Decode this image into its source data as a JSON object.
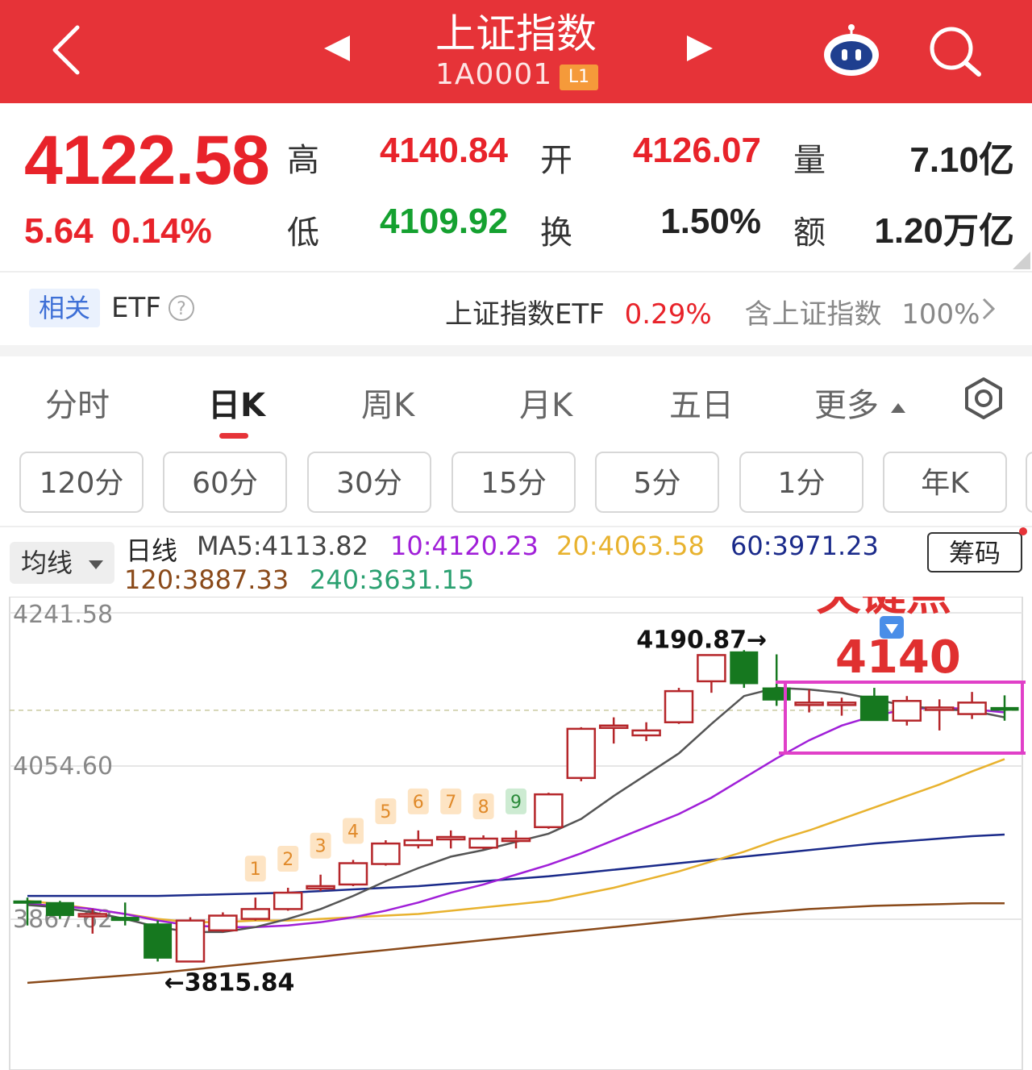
{
  "header": {
    "title": "上证指数",
    "code": "1A0001",
    "level_badge": "L1"
  },
  "quote": {
    "price": "4122.58",
    "change": "5.64",
    "change_pct": "0.14%",
    "high_label": "高",
    "high": "4140.84",
    "open_label": "开",
    "open": "4126.07",
    "volume_label": "量",
    "volume": "7.10亿",
    "low_label": "低",
    "low": "4109.92",
    "turnover_label": "换",
    "turnover": "1.50%",
    "amount_label": "额",
    "amount": "1.20万亿"
  },
  "etf": {
    "tag": "相关",
    "label": "ETF",
    "name": "上证指数ETF",
    "pct": "0.29%",
    "contain_text": "含上证指数",
    "contain_pct": "100%"
  },
  "tabs": [
    "分时",
    "日K",
    "周K",
    "月K",
    "五日",
    "更多"
  ],
  "active_tab": "日K",
  "periods": [
    "120分",
    "60分",
    "30分",
    "15分",
    "5分",
    "1分",
    "年K"
  ],
  "legend": {
    "ma_button": "均线",
    "line_name": "日线",
    "ma5": "MA5:4113.82",
    "ma10": "10:4120.23",
    "ma20": "20:4063.58",
    "ma60": "60:3971.23",
    "ma120": "120:3887.33",
    "ma240": "240:3631.15",
    "chip_button": "筹码"
  },
  "colors": {
    "header_red": "#e63338",
    "up": "#b5262a",
    "down": "#16781f",
    "ma5": "#555555",
    "ma10": "#a01fd8",
    "ma20": "#e8b22e",
    "ma60": "#1a2a8a",
    "ma120": "#8a4a1a",
    "ma240": "#2aa070",
    "annotation": "#e03030",
    "box": "#e040c8"
  },
  "chart_data": {
    "type": "candlestick",
    "y_axis_ticks": [
      "4241.58",
      "4054.60",
      "3867.62"
    ],
    "ylim": [
      3800,
      4241.58
    ],
    "max_label": "4190.87→",
    "min_label": "←3815.84",
    "annotation_title": "关键点",
    "annotation_value": "4140",
    "annotation_icon": "down-arrow-icon",
    "count_labels": [
      "1",
      "2",
      "3",
      "4",
      "5",
      "6",
      "7",
      "8",
      "9"
    ],
    "candles": [
      {
        "o": 3890,
        "h": 3894,
        "l": 3860,
        "c": 3888
      },
      {
        "o": 3888,
        "h": 3890,
        "l": 3868,
        "c": 3872
      },
      {
        "o": 3874,
        "h": 3880,
        "l": 3850,
        "c": 3874
      },
      {
        "o": 3870,
        "h": 3888,
        "l": 3860,
        "c": 3866
      },
      {
        "o": 3862,
        "h": 3866,
        "l": 3816,
        "c": 3820
      },
      {
        "o": 3816,
        "h": 3870,
        "l": 3815,
        "c": 3866
      },
      {
        "o": 3854,
        "h": 3876,
        "l": 3852,
        "c": 3872
      },
      {
        "o": 3868,
        "h": 3894,
        "l": 3866,
        "c": 3880
      },
      {
        "o": 3880,
        "h": 3906,
        "l": 3878,
        "c": 3900
      },
      {
        "o": 3906,
        "h": 3922,
        "l": 3902,
        "c": 3908
      },
      {
        "o": 3910,
        "h": 3940,
        "l": 3908,
        "c": 3936
      },
      {
        "o": 3935,
        "h": 3964,
        "l": 3933,
        "c": 3960
      },
      {
        "o": 3958,
        "h": 3976,
        "l": 3954,
        "c": 3964
      },
      {
        "o": 3966,
        "h": 3976,
        "l": 3954,
        "c": 3968
      },
      {
        "o": 3955,
        "h": 3970,
        "l": 3953,
        "c": 3966
      },
      {
        "o": 3966,
        "h": 3976,
        "l": 3954,
        "c": 3966
      },
      {
        "o": 3980,
        "h": 4022,
        "l": 3978,
        "c": 4020
      },
      {
        "o": 4040,
        "h": 4102,
        "l": 4036,
        "c": 4100
      },
      {
        "o": 4102,
        "h": 4114,
        "l": 4082,
        "c": 4104
      },
      {
        "o": 4092,
        "h": 4108,
        "l": 4085,
        "c": 4098
      },
      {
        "o": 4108,
        "h": 4150,
        "l": 4106,
        "c": 4146
      },
      {
        "o": 4158,
        "h": 4190,
        "l": 4144,
        "c": 4190
      },
      {
        "o": 4194,
        "h": 4196,
        "l": 4150,
        "c": 4155
      },
      {
        "o": 4150,
        "h": 4190.87,
        "l": 4128,
        "c": 4135
      },
      {
        "o": 4132,
        "h": 4148,
        "l": 4120,
        "c": 4132
      },
      {
        "o": 4132,
        "h": 4138,
        "l": 4116,
        "c": 4132
      },
      {
        "o": 4140,
        "h": 4150,
        "l": 4110,
        "c": 4110
      },
      {
        "o": 4110,
        "h": 4140,
        "l": 4104,
        "c": 4134
      },
      {
        "o": 4126,
        "h": 4136,
        "l": 4098,
        "c": 4126
      },
      {
        "o": 4118,
        "h": 4145,
        "l": 4112,
        "c": 4132
      },
      {
        "o": 4126.07,
        "h": 4140.84,
        "l": 4109.92,
        "c": 4122.58
      }
    ],
    "ma5": [
      3885,
      3882,
      3876,
      3868,
      3858,
      3852,
      3852,
      3858,
      3868,
      3880,
      3896,
      3914,
      3930,
      3944,
      3952,
      3962,
      3972,
      3990,
      4018,
      4044,
      4070,
      4106,
      4140,
      4150,
      4148,
      4144,
      4136,
      4128,
      4124,
      4122,
      4114
    ],
    "ma10": [
      3886,
      3884,
      3880,
      3874,
      3866,
      3860,
      3858,
      3858,
      3860,
      3864,
      3870,
      3878,
      3888,
      3900,
      3910,
      3922,
      3934,
      3948,
      3964,
      3980,
      3996,
      4016,
      4040,
      4064,
      4086,
      4104,
      4116,
      4124,
      4126,
      4124,
      4120
    ],
    "ma20": [
      3890,
      3886,
      3880,
      3874,
      3868,
      3864,
      3864,
      3866,
      3866,
      3868,
      3870,
      3872,
      3874,
      3878,
      3882,
      3886,
      3890,
      3898,
      3906,
      3916,
      3926,
      3938,
      3950,
      3964,
      3976,
      3990,
      4004,
      4018,
      4032,
      4048,
      4063
    ],
    "ma60": [
      3896,
      3896,
      3896,
      3896,
      3896,
      3897,
      3898,
      3899,
      3900,
      3902,
      3904,
      3906,
      3908,
      3911,
      3914,
      3917,
      3920,
      3924,
      3928,
      3932,
      3936,
      3940,
      3944,
      3948,
      3952,
      3956,
      3960,
      3963,
      3966,
      3969,
      3971
    ],
    "ma120": [
      3790,
      3793,
      3796,
      3799,
      3802,
      3806,
      3810,
      3814,
      3818,
      3822,
      3826,
      3830,
      3834,
      3838,
      3842,
      3846,
      3850,
      3854,
      3858,
      3862,
      3866,
      3870,
      3874,
      3877,
      3880,
      3882,
      3884,
      3885,
      3886,
      3887,
      3887
    ]
  }
}
